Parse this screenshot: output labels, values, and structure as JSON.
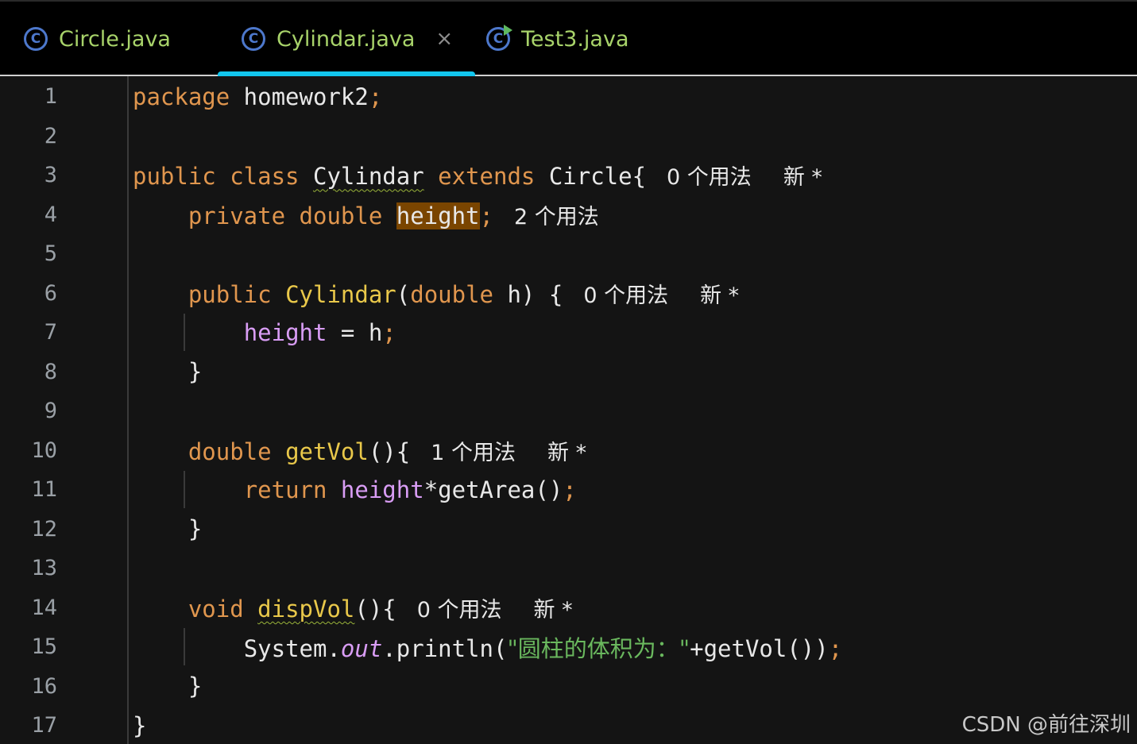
{
  "tabs": [
    {
      "label": "Circle.java",
      "icon": "class-icon",
      "active": false
    },
    {
      "label": "Cylindar.java",
      "icon": "class-icon",
      "active": true,
      "close": "×"
    },
    {
      "label": "Test3.java",
      "icon": "runnable-class-icon",
      "active": false
    }
  ],
  "line_numbers": [
    "1",
    "2",
    "3",
    "4",
    "5",
    "6",
    "7",
    "8",
    "9",
    "10",
    "11",
    "12",
    "13",
    "14",
    "15",
    "16",
    "17"
  ],
  "code": {
    "l1": {
      "kw": "package",
      "rest": " homework2",
      "semi": ";"
    },
    "l3": {
      "kw1": "public class",
      "cls": "Cylindar",
      "kw2": "extends",
      "rest": " Circle{",
      "hint_usage": "0 个用法",
      "hint_new": "新 *"
    },
    "l4": {
      "kw": "private double",
      "field": "height",
      "semi": ";",
      "hint_usage": "2 个用法"
    },
    "l6": {
      "kw": "public",
      "fn": "Cylindar",
      "p1": "(",
      "kw2": "double",
      "rest": " h) {",
      "hint_usage": "0 个用法",
      "hint_new": "新 *"
    },
    "l7": {
      "field": "height",
      "rest": " = h",
      "semi": ";"
    },
    "l8": {
      "text": "}"
    },
    "l10": {
      "kw": "double",
      "fn": "getVol",
      "rest": "(){",
      "hint_usage": "1 个用法",
      "hint_new": "新 *"
    },
    "l11": {
      "kw": "return",
      "field": "height",
      "rest": "*getArea()",
      "semi": ";"
    },
    "l12": {
      "text": "}"
    },
    "l14": {
      "kw": "void",
      "fn": "dispVol",
      "rest": "(){",
      "hint_usage": "0 个用法",
      "hint_new": "新 *"
    },
    "l15": {
      "a": "System.",
      "out": "out",
      "b": ".println(",
      "str": "\"圆柱的体积为：\"",
      "c": "+getVol())",
      "semi": ";"
    },
    "l16": {
      "text": "}"
    },
    "l17": {
      "text": "}"
    }
  },
  "watermark": "CSDN @前往深圳",
  "colors": {
    "keyword": "#e0964e",
    "function": "#e9c84a",
    "field": "#d99df5",
    "string": "#6ab85e",
    "tab_text": "#a8d36a",
    "active_tab_underline": "#12c6ee"
  }
}
